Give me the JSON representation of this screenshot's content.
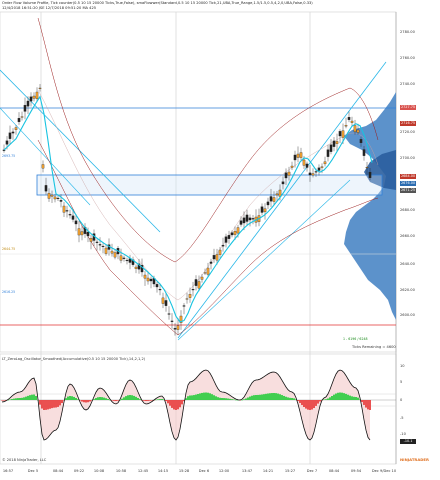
{
  "header": {
    "line1": "Order Flow Volume Profile, Tick counter(0.5 10 15 20000 Ticks,True,False), smaFlowwer(Standard,0.5 10 15 20000 Tick,21,UBA,True_Range,1.5/1.5,0.5,4,2,0,UBA,False,0.33)",
    "line2": "12/4/2018 16:51:20 JSE    12/7/2018 09:51:20 MA 425"
  },
  "price_axis": {
    "labels": [
      "2780.00",
      "2760.00",
      "2740.00",
      "2720.00",
      "2700.00",
      "2680.00",
      "2660.00",
      "2640.00",
      "2620.00",
      "2600.00"
    ],
    "tags": [
      {
        "text": "2727.75",
        "color": "#d9534f"
      },
      {
        "text": "2716.75",
        "color": "#c0392b"
      },
      {
        "text": "2684.00",
        "color": "#c0392b"
      },
      {
        "text": "2676.00",
        "color": "#2b6cb0"
      },
      {
        "text": "2671.25",
        "color": "#555555"
      }
    ]
  },
  "price_panel": {
    "ticks_remaining": "Ticks Remaining = 4600",
    "left_labels": [
      "2693.75",
      "2644.75",
      "2616.25"
    ],
    "bottom_note": "1 - 6196 / 6248"
  },
  "oscillator": {
    "title": "LT_ZeroLag_Oscillator_Smoothed(Accumulative(0.5 10 15 20000 Tick),14,2,1,2)",
    "axis_labels": [
      "10",
      "5",
      "0",
      "-5",
      "-10"
    ],
    "value_tag": "-10.1"
  },
  "time_axis": [
    "16:57",
    "Dec 5",
    "08:44",
    "09:22",
    "10:08",
    "10:58",
    "12:45",
    "14:15",
    "15:28",
    "Dec 6",
    "12:00",
    "13:47",
    "14:21",
    "15:27",
    "Dec 7",
    "08:44",
    "09:54",
    "Dec 9/Dec 10"
  ],
  "footer": {
    "copyright": "© 2018 NinjaTrader, LLC",
    "brand": "NINJATRADER"
  },
  "colors": {
    "candle_up": "#f0a030",
    "candle_down": "#222222",
    "ma_line": "#17c3e0",
    "envelope": "#9b1c1c",
    "channel": "#2ab7e8",
    "profile": "#4a86c5",
    "hline_blue": "#2f7fd8",
    "hline_red": "#e03030",
    "osc_up": "#2ecc40",
    "osc_down": "#e84040"
  }
}
